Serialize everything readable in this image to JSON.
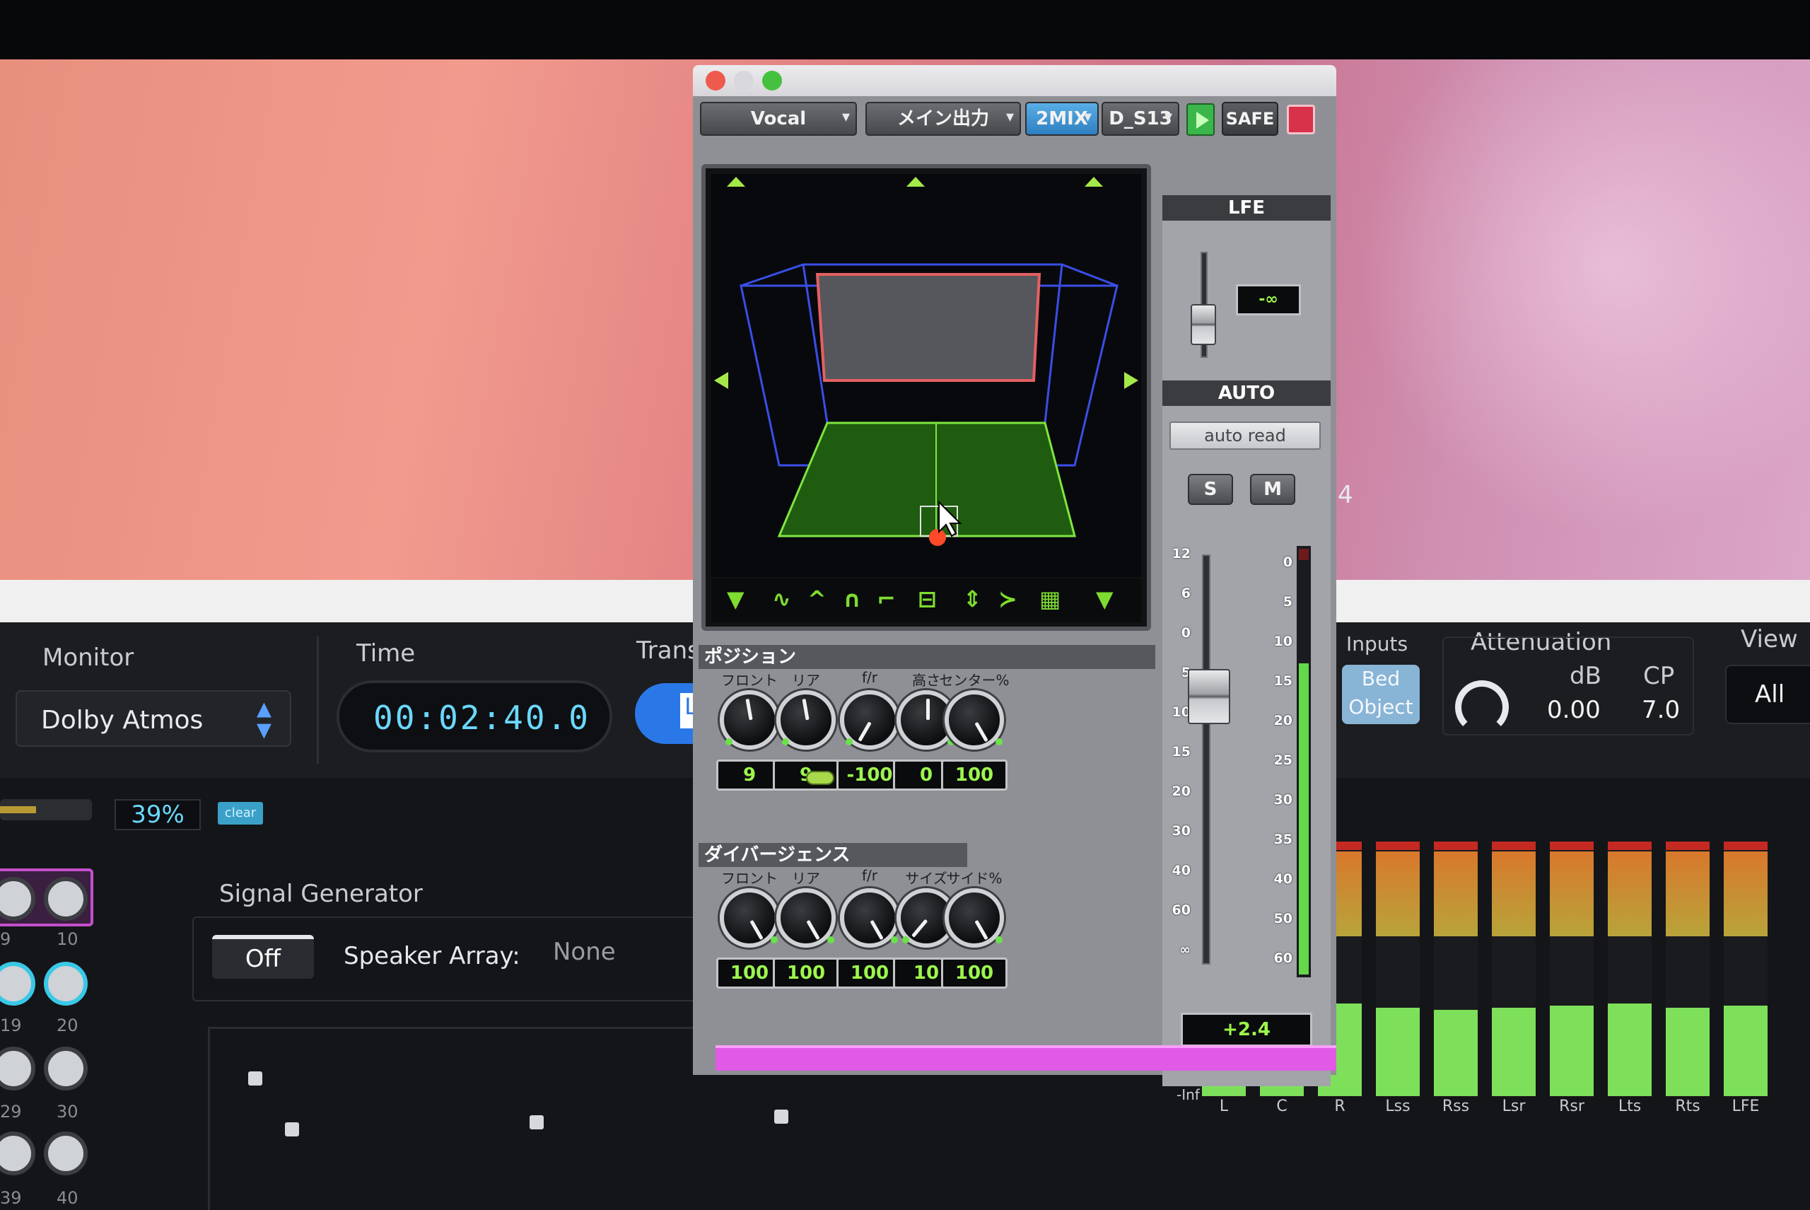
{
  "monitor": {
    "label": "Monitor",
    "value": "Dolby Atmos"
  },
  "time": {
    "label": "Time",
    "value": "00:02:40.0"
  },
  "transport": {
    "label": "Trans",
    "button": "L"
  },
  "progress": {
    "percent_text": "39%",
    "clear_label": "clear",
    "fraction": 0.39
  },
  "speakers": {
    "numbers": [
      "9",
      "10",
      "19",
      "20",
      "29",
      "30",
      "39",
      "40"
    ]
  },
  "signal_generator": {
    "title": "Signal Generator",
    "off_label": "Off",
    "array_label": "Speaker Array:",
    "array_value": "None"
  },
  "inputs": {
    "label": "Inputs",
    "bed": "Bed",
    "object": "Object"
  },
  "attenuation": {
    "label": "Attenuation",
    "db_label": "dB",
    "cp_label": "CP",
    "db_value": "0.00",
    "cp_value": "7.0"
  },
  "view": {
    "label": "View",
    "value": "All"
  },
  "misc_label": "4",
  "meters": {
    "labels": [
      "L",
      "C",
      "R",
      "Lss",
      "Rss",
      "Lsr",
      "Rsr",
      "Lts",
      "Rts",
      "LFE"
    ],
    "scale_bottom": "-Inf",
    "levels": [
      0.08,
      0.08,
      0.35,
      0.33,
      0.32,
      0.33,
      0.34,
      0.35,
      0.33,
      0.34
    ]
  },
  "plugin": {
    "toolbar": {
      "track": "Vocal",
      "output": "メイン出力",
      "mix": "2MIX",
      "device": "D_S13",
      "safe": "SAFE"
    },
    "position": {
      "title": "ポジション",
      "knobs": [
        {
          "label": "フロント",
          "value": "9"
        },
        {
          "label": "リア",
          "value": "9"
        },
        {
          "label": "f/r",
          "value": "-100"
        },
        {
          "label": "高さ",
          "value": "0"
        },
        {
          "label": "センター%",
          "value": "100"
        }
      ]
    },
    "divergence": {
      "title": "ダイバージェンス",
      "knobs": [
        {
          "label": "フロント",
          "value": "100"
        },
        {
          "label": "リア",
          "value": "100"
        },
        {
          "label": "f/r",
          "value": "100"
        },
        {
          "label": "サイズ",
          "value": "10"
        },
        {
          "label": "サイド%",
          "value": "100"
        }
      ]
    },
    "lfe": {
      "title": "LFE",
      "value": "-∞"
    },
    "auto": {
      "title": "AUTO",
      "mode": "auto read"
    },
    "solo": "S",
    "mute": "M",
    "fader_scale": [
      "12",
      "6",
      "0",
      "5",
      "10",
      "15",
      "20",
      "30",
      "40",
      "60",
      "∞"
    ],
    "meter_scale": [
      "0",
      "5",
      "10",
      "15",
      "20",
      "25",
      "30",
      "35",
      "40",
      "50",
      "60"
    ],
    "volume": "+2.4"
  },
  "colors": {
    "green": "#9cf64d",
    "blue_room": "#4a63ff",
    "pink": "#e05ae6",
    "accent_blue": "#6ad8ff"
  }
}
